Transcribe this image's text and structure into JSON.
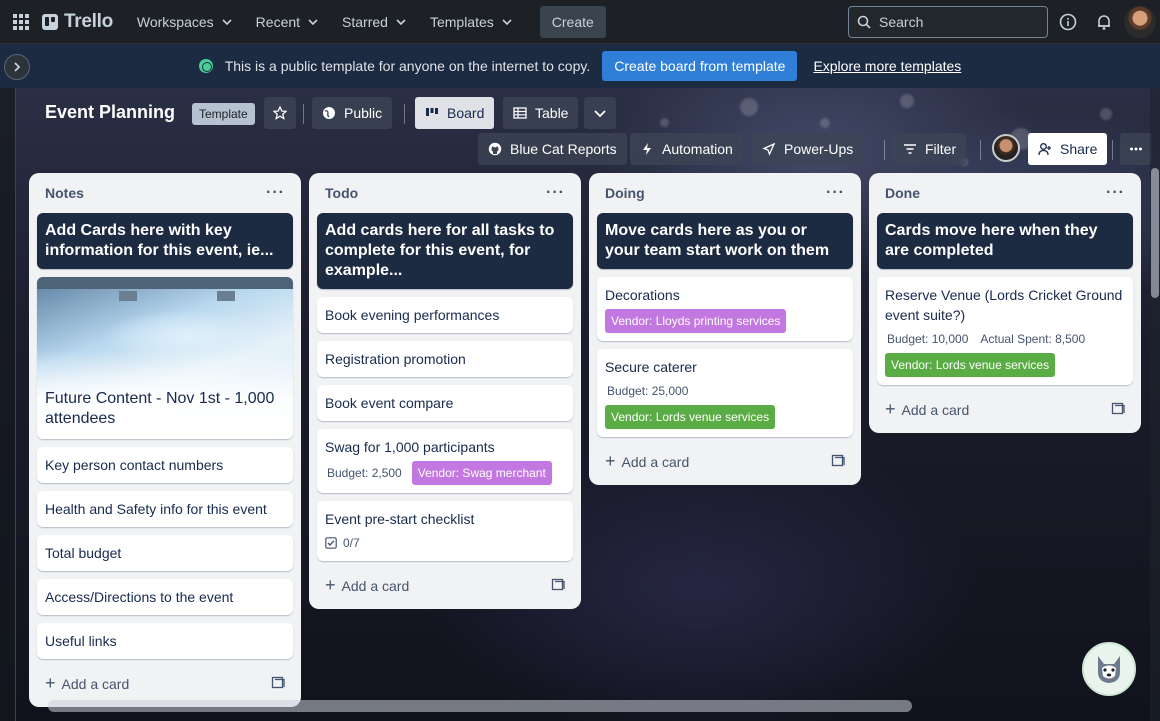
{
  "topnav": {
    "logo": "Trello",
    "menus": [
      "Workspaces",
      "Recent",
      "Starred",
      "Templates"
    ],
    "create": "Create",
    "search_placeholder": "Search"
  },
  "banner": {
    "text": "This is a public template for anyone on the internet to copy.",
    "button": "Create board from template",
    "link": "Explore more templates"
  },
  "board": {
    "title": "Event Planning",
    "badge": "Template",
    "visibility": "Public",
    "view_board": "Board",
    "view_table": "Table",
    "powerups": [
      "Blue Cat Reports",
      "Automation",
      "Power-Ups"
    ],
    "filter": "Filter",
    "share": "Share"
  },
  "lists": [
    {
      "title": "Notes",
      "header_card": "Add Cards here with key information for this event, ie...",
      "image_card": "Future Content - Nov 1st - 1,000 attendees",
      "cards": [
        "Key person contact numbers",
        "Health and Safety info for this event",
        "Total budget",
        "Access/Directions to the event",
        "Useful links"
      ],
      "add": "Add a card"
    },
    {
      "title": "Todo",
      "header_card": "Add cards here for all tasks to complete for this event, for example...",
      "cards": [
        "Book evening performances",
        "Registration promotion",
        "Book event compare"
      ],
      "swag": {
        "title": "Swag for 1,000 participants",
        "budget": "Budget: 2,500",
        "label": "Vendor: Swag merchant"
      },
      "checklist": {
        "title": "Event pre-start checklist",
        "progress": "0/7"
      },
      "add": "Add a card"
    },
    {
      "title": "Doing",
      "header_card": "Move cards here as you or your team start work on them",
      "deco": {
        "title": "Decorations",
        "label": "Vendor: Lloyds printing services"
      },
      "caterer": {
        "title": "Secure caterer",
        "budget": "Budget: 25,000",
        "label": "Vendor: Lords venue services"
      },
      "add": "Add a card"
    },
    {
      "title": "Done",
      "header_card": "Cards move here when they are completed",
      "venue": {
        "title": "Reserve Venue (Lords Cricket Ground event suite?)",
        "budget": "Budget: 10,000",
        "spent": "Actual Spent: 8,500",
        "label": "Vendor: Lords venue services"
      },
      "add": "Add a card"
    }
  ],
  "colors": {
    "label_purple": "#c377e0",
    "label_green": "#5aac44",
    "banner_button": "#2f7fd8",
    "dark_card": "#1c2b41"
  },
  "icons": [
    "apps-icon",
    "chevron-down-icon",
    "search-icon",
    "info-icon",
    "bell-icon",
    "globe-icon",
    "star-icon",
    "board-icon",
    "table-icon",
    "github-icon",
    "lightning-icon",
    "rocket-icon",
    "filter-icon",
    "share-user-icon",
    "more-icon",
    "template-icon",
    "checklist-icon",
    "husky-icon"
  ]
}
